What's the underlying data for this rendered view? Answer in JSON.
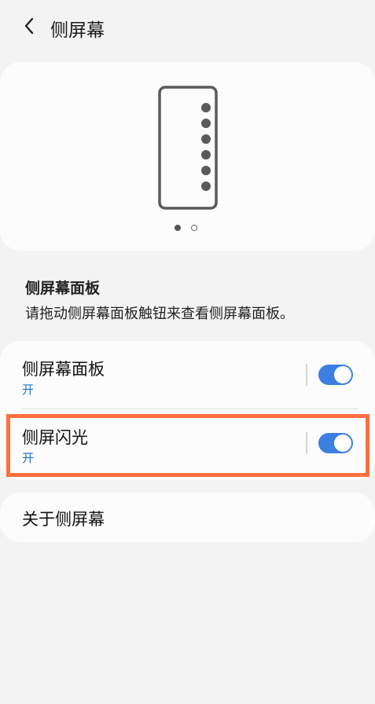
{
  "header": {
    "title": "侧屏幕",
    "back_icon": "chevron-left-icon"
  },
  "preview": {
    "illustration_icon": "edge-screen-phone-icon",
    "pager": {
      "total": 2,
      "active": 1
    }
  },
  "section": {
    "title": "侧屏幕面板",
    "description": "请拖动侧屏幕面板触钮来查看侧屏幕面板。"
  },
  "settings": [
    {
      "label": "侧屏幕面板",
      "status": "开",
      "enabled": true
    },
    {
      "label": "侧屏闪光",
      "status": "开",
      "enabled": true
    }
  ],
  "about": {
    "label": "关于侧屏幕"
  },
  "colors": {
    "accent": "#3c7fe0",
    "status_text": "#1a73c8",
    "highlight": "#ff6f3d",
    "background": "#f3f3f3"
  }
}
